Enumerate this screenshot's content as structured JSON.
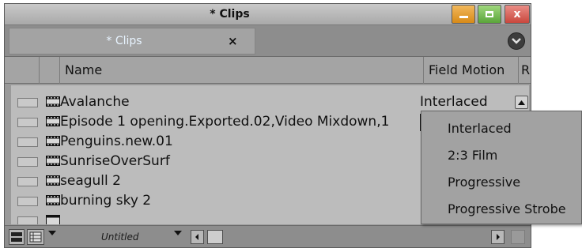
{
  "window": {
    "title": "* Clips",
    "minimize_icon": "minimize-icon",
    "maximize_icon": "maximize-icon",
    "close_icon": "close-icon",
    "close_glyph": "x"
  },
  "tab": {
    "label": "* Clips",
    "close_glyph": "×",
    "menu_icon": "chevron-down-circle-icon"
  },
  "columns": {
    "name": "Name",
    "field_motion": "Field Motion",
    "r": "R"
  },
  "rows": [
    {
      "name": "Avalanche",
      "field_motion": "Interlaced"
    },
    {
      "name": "Episode 1 opening.Exported.02,Video Mixdown,1",
      "field_motion": ""
    },
    {
      "name": "Penguins.new.01",
      "field_motion": ""
    },
    {
      "name": "SunriseOverSurf",
      "field_motion": ""
    },
    {
      "name": "seagull 2",
      "field_motion": ""
    },
    {
      "name": "burning sky 2",
      "field_motion": ""
    }
  ],
  "field_motion_menu": {
    "options": [
      "Interlaced",
      "2:3 Film",
      "Progressive",
      "Progressive Strobe"
    ]
  },
  "bottom_bar": {
    "view_name": "Untitled",
    "icons": [
      "frame-view-icon",
      "list-view-icon",
      "scroll-left-icon",
      "scroll-right-icon"
    ]
  },
  "colors": {
    "tab_text": "#e8f4ff",
    "minimize": "#e59e34",
    "maximize": "#74bb52",
    "close": "#d9554b"
  }
}
